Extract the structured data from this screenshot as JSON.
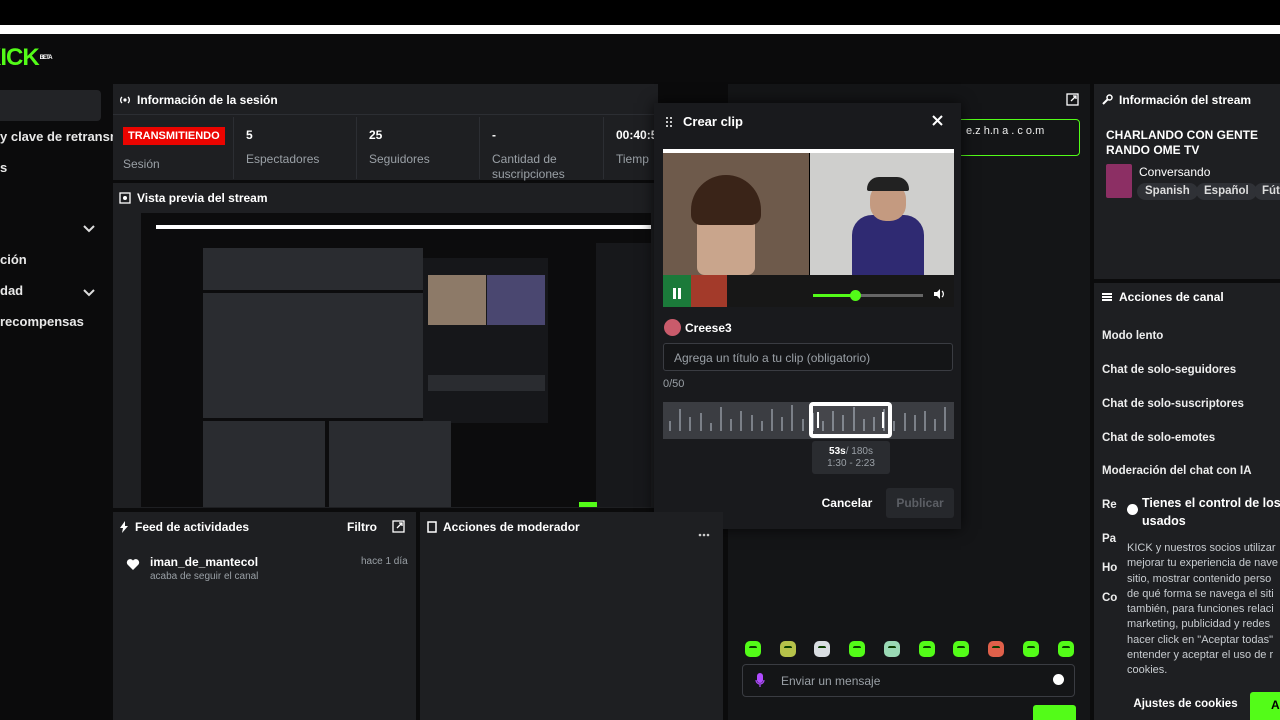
{
  "brand": {
    "logo": "KICK",
    "badge": "BETA"
  },
  "sidebar": {
    "items": [
      {
        "label": "y clave de retransm"
      },
      {
        "label": "s"
      },
      {
        "label": "ción"
      },
      {
        "label": "dad"
      },
      {
        "label": "recompensas"
      }
    ]
  },
  "session": {
    "title": "Información de la sesión",
    "status_badge": "TRANSMITIENDO",
    "status_label": "Sesión",
    "stats": [
      {
        "value": "5",
        "label": "Espectadores"
      },
      {
        "value": "25",
        "label": "Seguidores"
      },
      {
        "value": "-",
        "label": "Cantidad de suscripciones"
      },
      {
        "value": "00:40:5",
        "label": "Tiemp"
      }
    ]
  },
  "preview": {
    "title": "Vista previa del stream"
  },
  "clip_modal": {
    "title": "Crear clip",
    "username": "Creese3",
    "title_placeholder": "Agrega un título a tu clip (obligatorio)",
    "char_count": "0/50",
    "duration": "53s",
    "duration_max": "/ 180s",
    "range": "1:30 - 2:23",
    "cancel_label": "Cancelar",
    "publish_label": "Publicar",
    "progress": 0.38
  },
  "chat": {
    "url_fragment": "e.z h.n a . c o.m",
    "input_placeholder": "Enviar un mensaje"
  },
  "stream_info": {
    "title": "Información del stream",
    "stream_title": "CHARLANDO CON GENTE RANDO OME TV",
    "category": "Conversando",
    "tags": [
      "Spanish",
      "Español",
      "Fút"
    ]
  },
  "channel_actions": {
    "title": "Acciones de canal",
    "items": [
      "Modo lento",
      "Chat de solo-seguidores",
      "Chat de solo-suscriptores",
      "Chat de solo-emotes",
      "Moderación del chat con IA"
    ],
    "peek": [
      "Re",
      "Pa",
      "Ho",
      "Co"
    ]
  },
  "cookie": {
    "title": "Tienes el control de los usados",
    "lines": [
      "KICK y nuestros socios utilizar",
      "mejorar tu experiencia de nave",
      "sitio, mostrar contenido perso",
      "de qué forma se navega el siti",
      "también, para funciones relaci",
      "marketing, publicidad y redes",
      "hacer click en \"Aceptar todas\"",
      "entender y aceptar el uso de r",
      "cookies."
    ],
    "settings_label": "Ajustes de cookies",
    "accept_label": "A"
  },
  "activity": {
    "title": "Feed de actividades",
    "filter_label": "Filtro",
    "event_user": "iman_de_mantecol",
    "event_time": "hace 1 día",
    "event_text": "acaba de seguir el canal"
  },
  "mod_actions": {
    "title": "Acciones de moderador"
  },
  "colors": {
    "accent": "#53fc18",
    "live": "#eb0400",
    "panel": "#1e1f22"
  }
}
